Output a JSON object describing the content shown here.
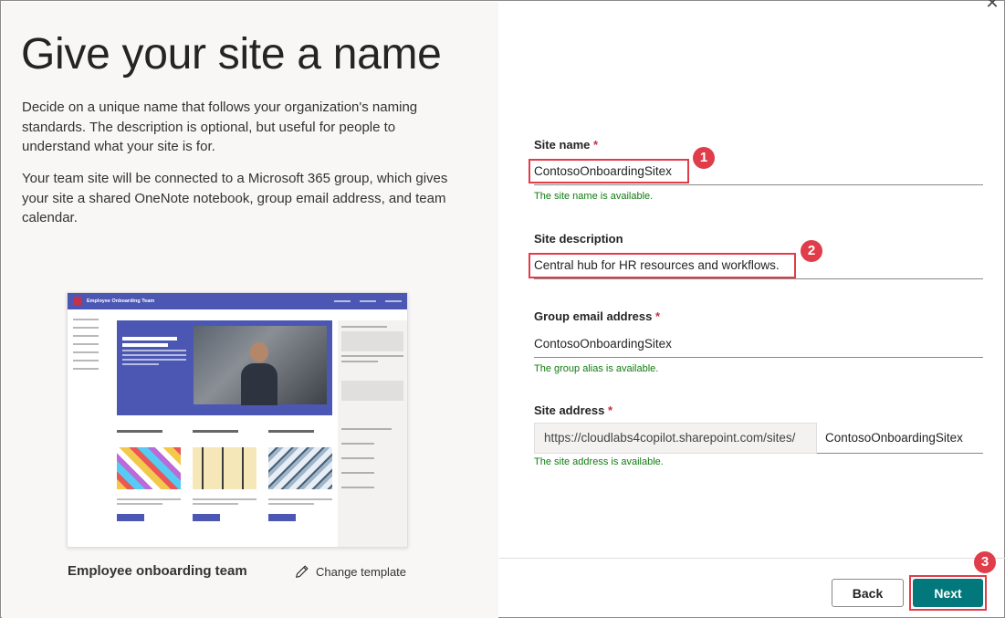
{
  "left": {
    "title": "Give your site a name",
    "paragraph1": "Decide on a unique name that follows your organization's naming standards. The description is optional, but useful for people to understand what your site is for.",
    "paragraph2": "Your team site will be connected to a Microsoft 365 group, which gives your site a shared OneNote notebook, group email address, and team calendar.",
    "preview_title": "Employee Onboarding Team",
    "template_name": "Employee onboarding team",
    "change_template_label": "Change template"
  },
  "form": {
    "site_name": {
      "label": "Site name",
      "required_mark": "*",
      "value": "ContosoOnboardingSitex",
      "hint": "The site name is available."
    },
    "site_description": {
      "label": "Site description",
      "value": "Central hub for HR resources and workflows."
    },
    "group_email": {
      "label": "Group email address",
      "required_mark": "*",
      "value": "ContosoOnboardingSitex",
      "hint": "The group alias is available."
    },
    "site_address": {
      "label": "Site address",
      "required_mark": "*",
      "prefix": "https://cloudlabs4copilot.sharepoint.com/sites/",
      "value": "ContosoOnboardingSitex",
      "hint": "The site address is available."
    }
  },
  "buttons": {
    "back": "Back",
    "next": "Next"
  },
  "annotations": {
    "badge1": "1",
    "badge2": "2",
    "badge3": "3"
  },
  "colors": {
    "accent": "#03787c",
    "highlight": "#e03c4a",
    "success_text": "#107c10",
    "preview_brand": "#4b57b3"
  },
  "icons": {
    "close": "close-icon",
    "change_template": "pencil-icon"
  }
}
